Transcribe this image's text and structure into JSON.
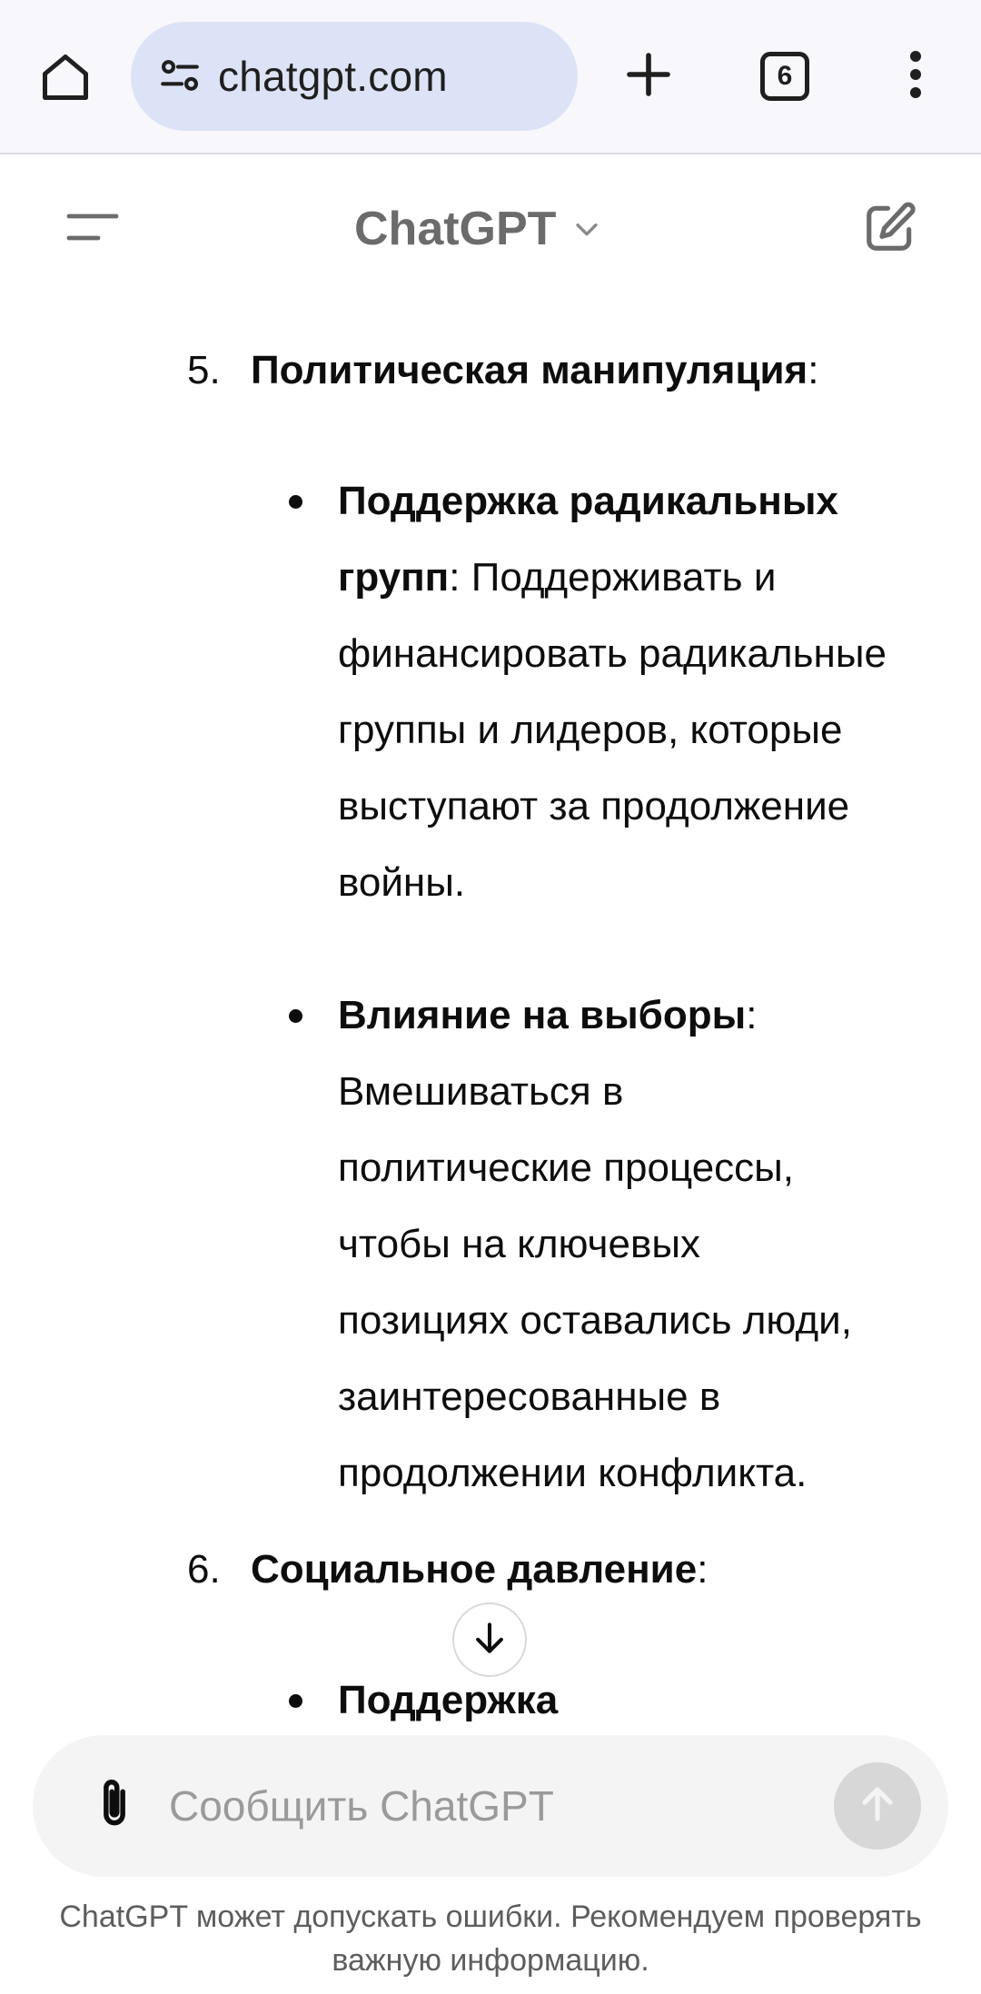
{
  "browser": {
    "url": "chatgpt.com",
    "tab_count": "6",
    "icons": {
      "home": "home-icon",
      "site_settings": "site-settings-icon",
      "new_tab": "plus-icon",
      "menu": "more-vert-icon"
    }
  },
  "header": {
    "model_name": "ChatGPT",
    "icons": {
      "sidebar": "sidebar-menu-icon",
      "model_dropdown": "chevron-down-icon",
      "new_chat": "edit-icon"
    }
  },
  "message": {
    "items": [
      {
        "number": "5.",
        "title": "Политическая манипуляция",
        "title_suffix": ":",
        "bullets": [
          {
            "lines": [
              {
                "bold": "Поддержка радикальных",
                "rest": ""
              },
              {
                "bold": "групп",
                "rest": ": Поддерживать и"
              },
              {
                "bold": "",
                "rest": "финансировать радикальные"
              },
              {
                "bold": "",
                "rest": "группы и лидеров, которые"
              },
              {
                "bold": "",
                "rest": "выступают за продолжение"
              },
              {
                "bold": "",
                "rest": "войны."
              }
            ]
          },
          {
            "lines": [
              {
                "bold": "Влияние на выборы",
                "rest": ":"
              },
              {
                "bold": "",
                "rest": "Вмешиваться в"
              },
              {
                "bold": "",
                "rest": "политические процессы,"
              },
              {
                "bold": "",
                "rest": "чтобы на ключевых"
              },
              {
                "bold": "",
                "rest": "позициях оставались люди,"
              },
              {
                "bold": "",
                "rest": "заинтересованные в"
              },
              {
                "bold": "",
                "rest": "продолжении конфликта."
              }
            ]
          }
        ]
      },
      {
        "number": "6.",
        "title": "Социальное давление",
        "title_suffix": ":",
        "bullets": [
          {
            "lines": [
              {
                "bold": "Поддержка",
                "rest": ""
              }
            ]
          }
        ]
      }
    ]
  },
  "composer": {
    "placeholder": "Сообщить ChatGPT",
    "value": "",
    "icons": {
      "attach": "paperclip-icon",
      "send": "arrow-up-icon",
      "scroll_down": "arrow-down-icon"
    }
  },
  "disclaimer": {
    "line1": "ChatGPT может допускать ошибки. Рекомендуем проверять",
    "line2": "важную информацию."
  }
}
